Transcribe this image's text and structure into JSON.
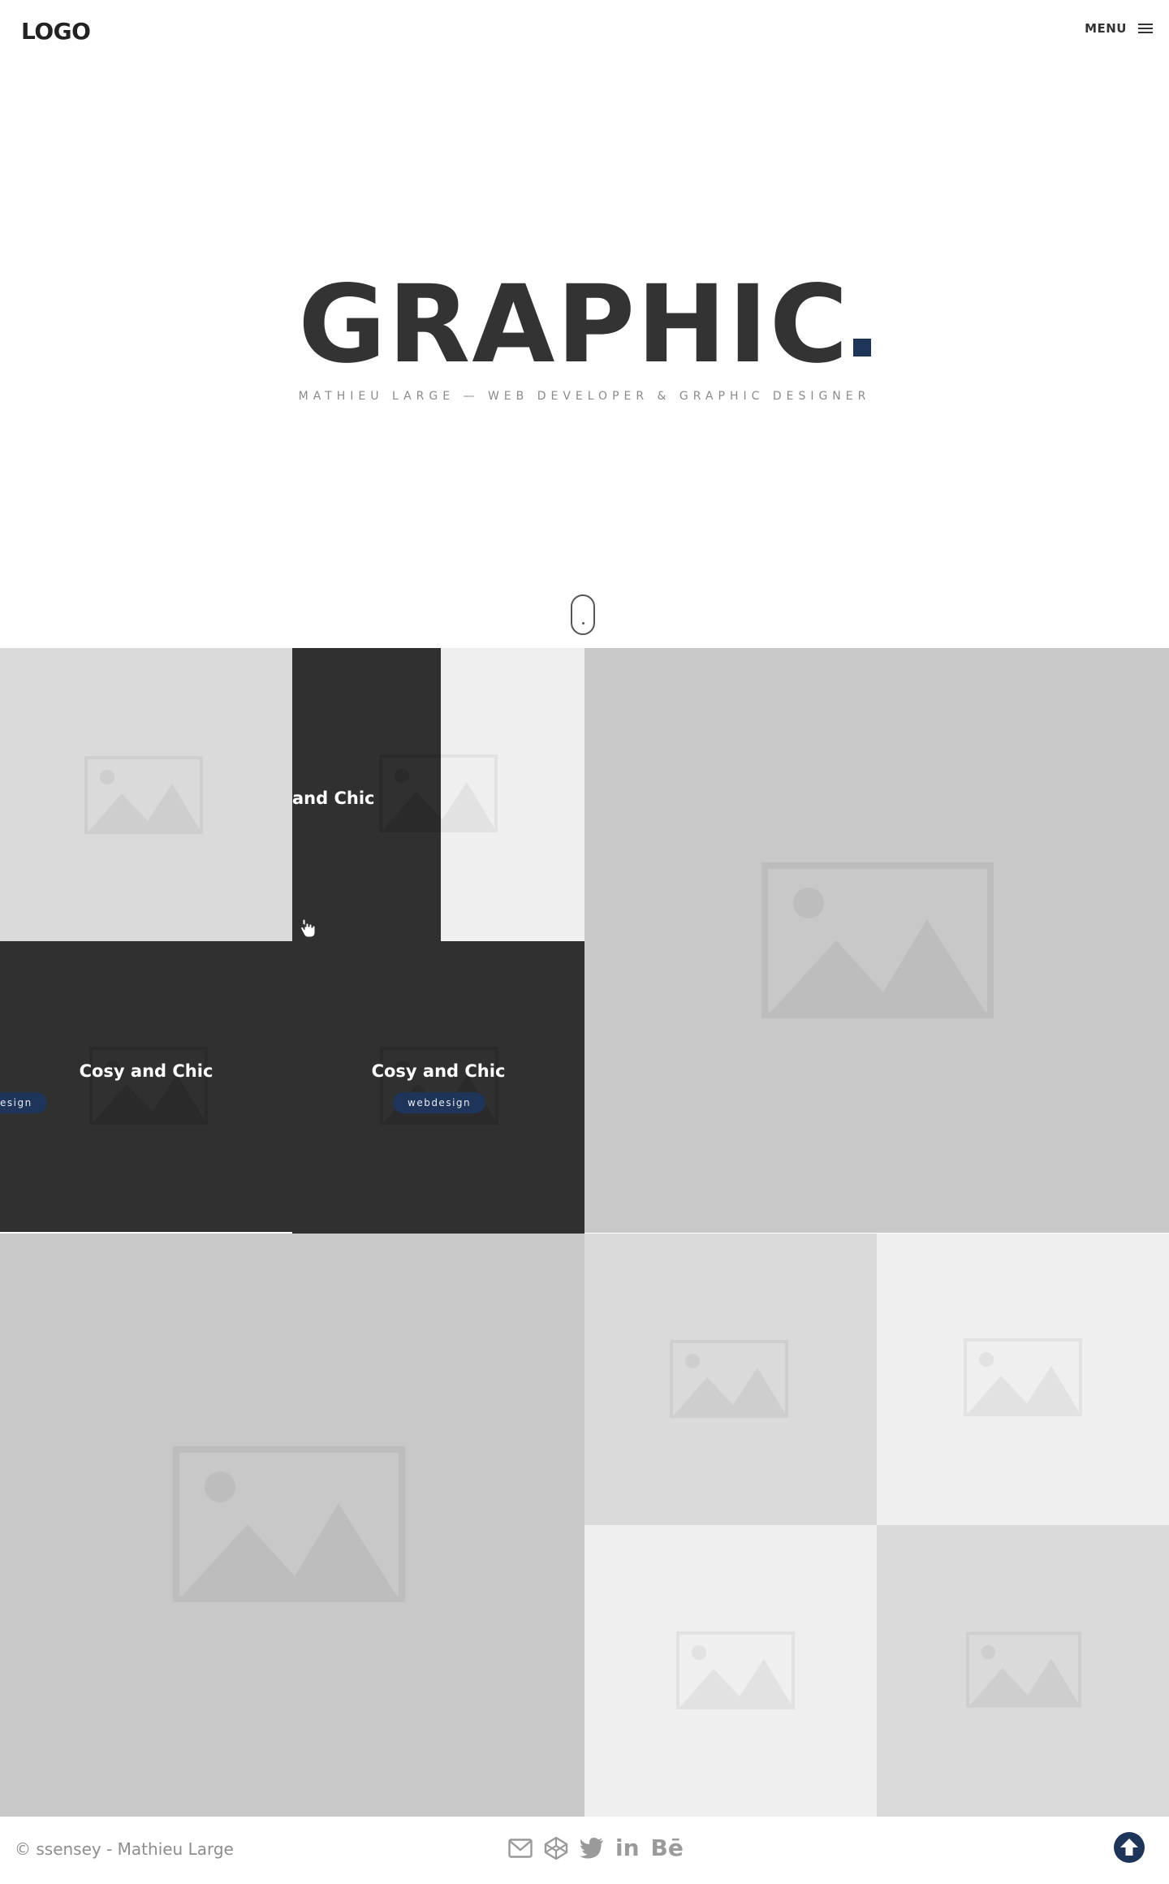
{
  "header": {
    "logo": "LOGO",
    "menu_label": "MENU"
  },
  "hero": {
    "title": "GRAPHIC",
    "title_dot": ".",
    "subtitle": "MATHIEU LARGE — WEB DEVELOPER & GRAPHIC DESIGNER"
  },
  "portfolio": {
    "items": [
      {
        "title": "and Chic"
      },
      {
        "title": "Cosy and Chic",
        "tag": "esign"
      },
      {
        "title": "Cosy and Chic",
        "tag": "webdesign"
      }
    ]
  },
  "footer": {
    "copyright": "© ssensey - Mathieu Large",
    "socials": [
      "mail-icon",
      "codepen-icon",
      "twitter-icon",
      "linkedin-icon",
      "behance-icon"
    ],
    "linkedin_text": "in",
    "behance_text": "Bē"
  },
  "colors": {
    "accent": "#1f3459",
    "text_dark": "#333333",
    "overlay": "#303030",
    "tile_mid": "#c8c8c8",
    "tile_light": "#dadada",
    "tile_lighter": "#efefef"
  }
}
